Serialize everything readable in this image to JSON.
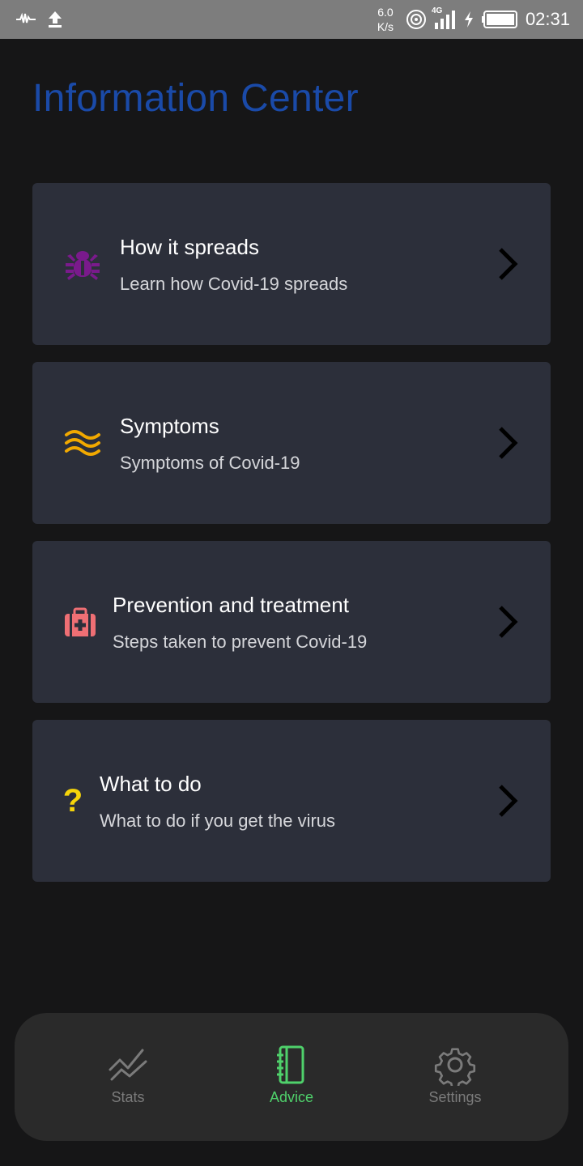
{
  "status_bar": {
    "speed_value": "6.0",
    "speed_unit": "K/s",
    "network": "4G",
    "time": "02:31"
  },
  "page": {
    "title": "Information Center"
  },
  "cards": [
    {
      "title": "How it spreads",
      "subtitle": "Learn how Covid-19 spreads",
      "icon": "bug-icon",
      "icon_color": "#7a1a8c"
    },
    {
      "title": "Symptoms",
      "subtitle": "Symptoms of Covid-19",
      "icon": "waves-icon",
      "icon_color": "#f2a900"
    },
    {
      "title": "Prevention and treatment",
      "subtitle": "Steps taken to prevent Covid-19",
      "icon": "first-aid-kit-icon",
      "icon_color": "#ef6f74"
    },
    {
      "title": "What to do",
      "subtitle": "What to do if you get the virus",
      "icon": "question-mark-icon",
      "icon_color": "#f5d40a",
      "icon_text": "?"
    }
  ],
  "bottom_nav": {
    "items": [
      {
        "label": "Stats",
        "icon": "stats-chart-icon",
        "active": false
      },
      {
        "label": "Advice",
        "icon": "notebook-icon",
        "active": true
      },
      {
        "label": "Settings",
        "icon": "gear-icon",
        "active": false
      }
    ],
    "active_color": "#4fd16b",
    "inactive_color": "#7b7b7b"
  }
}
